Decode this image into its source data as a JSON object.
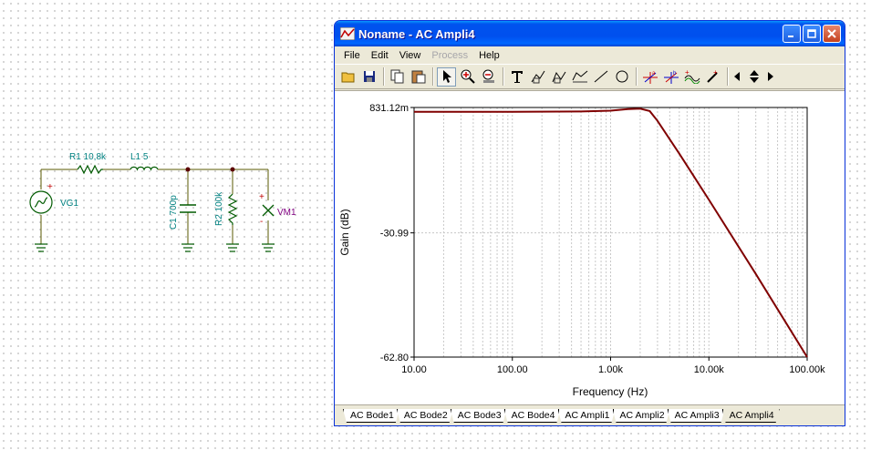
{
  "schematic": {
    "components": [
      {
        "id": "r1",
        "label": "R1 10,8k"
      },
      {
        "id": "l1",
        "label": "L1 5"
      },
      {
        "id": "c1",
        "label": "C1 700p"
      },
      {
        "id": "r2",
        "label": "R2 100k"
      },
      {
        "id": "vg1",
        "label": "VG1"
      },
      {
        "id": "vm1",
        "label": "VM1"
      }
    ],
    "plus_sign": "+",
    "minus_sign": "-"
  },
  "window": {
    "title": "Noname - AC Ampli4",
    "menu": [
      {
        "label": "File",
        "enabled": true
      },
      {
        "label": "Edit",
        "enabled": true
      },
      {
        "label": "View",
        "enabled": true
      },
      {
        "label": "Process",
        "enabled": false
      },
      {
        "label": "Help",
        "enabled": true
      }
    ],
    "toolbar_icons": [
      "open-icon",
      "save-icon",
      "copy-icon",
      "paste-icon",
      "pointer-icon",
      "zoom-in-icon",
      "zoom-100-icon",
      "text-icon",
      "formula-icon",
      "formula2-icon",
      "legend-icon",
      "line-icon",
      "circle-icon",
      "cursor-a-icon",
      "cursor-b-icon",
      "add-curve-icon",
      "add-marker-icon",
      "arrow-left-icon",
      "arrow-updown-icon",
      "arrow-right-icon"
    ],
    "tabs": [
      "AC Bode1",
      "AC Bode2",
      "AC Bode3",
      "AC Bode4",
      "AC Ampli1",
      "AC Ampli2",
      "AC Ampli3",
      "AC Ampli4"
    ],
    "active_tab": "AC Ampli4"
  },
  "chart_data": {
    "type": "line",
    "xlabel": "Frequency (Hz)",
    "ylabel": "Gain (dB)",
    "xscale": "log",
    "xlim": [
      10,
      100000
    ],
    "ylim": [
      -62.8,
      1.12
    ],
    "x_tick_labels": [
      "10.00",
      "100.00",
      "1.00k",
      "10.00k",
      "100.00k"
    ],
    "y_tick_labels": [
      "831.12m",
      "-30.99",
      "-62.80"
    ],
    "grid": true,
    "line_color": "#800000",
    "series": [
      {
        "x": [
          10,
          100,
          500,
          1000,
          1500,
          2000,
          2500,
          3000,
          5000,
          10000,
          30000,
          100000
        ],
        "y": [
          0.0,
          0.0,
          0.1,
          0.3,
          0.7,
          0.83,
          0.2,
          -2.3,
          -10.7,
          -22.5,
          -41.5,
          -62.8
        ]
      }
    ]
  }
}
